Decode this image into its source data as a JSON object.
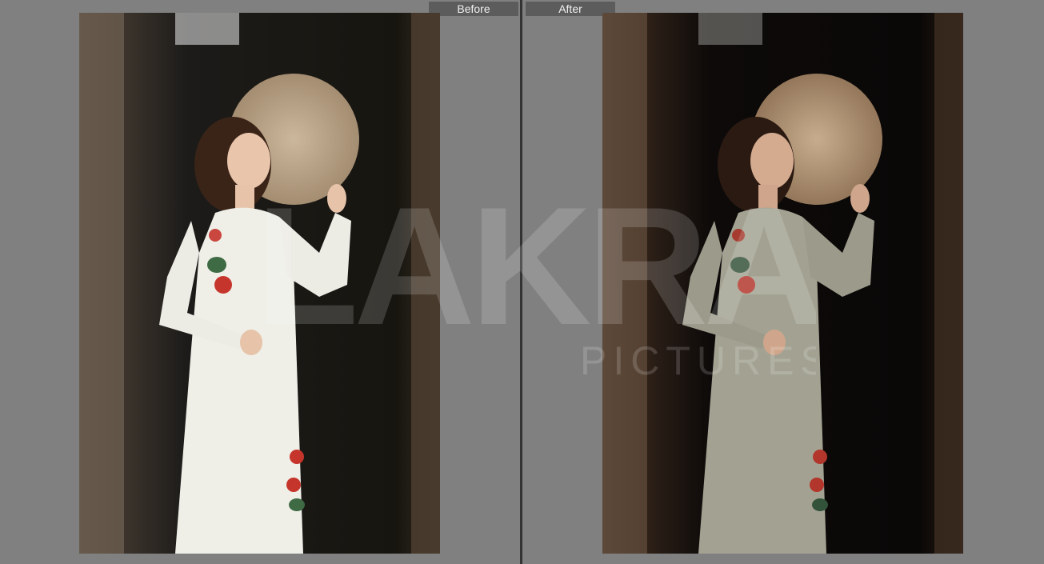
{
  "compare": {
    "before_label": "Before",
    "after_label": "After"
  },
  "watermark": {
    "brand": "LAKRA",
    "sub": "PICTURES"
  },
  "colors": {
    "background": "#808080",
    "divider": "#333333",
    "tab_bg": "#5c5c5c"
  }
}
